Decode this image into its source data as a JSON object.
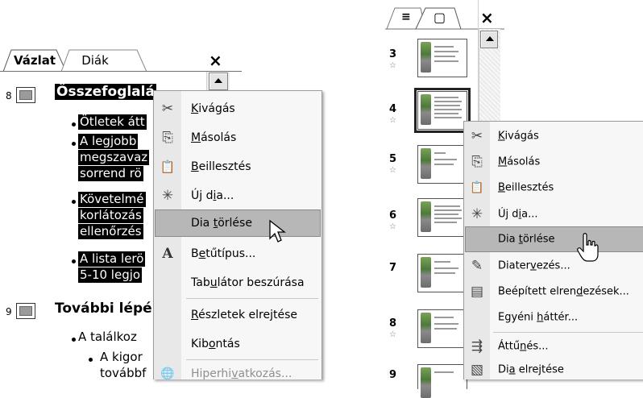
{
  "outline_pane": {
    "tabs": [
      "Vázlat",
      "Diák"
    ],
    "close": "×",
    "slides": [
      {
        "number": "8",
        "title": "Összefoglalás",
        "title_visible": "Összefoglalá",
        "bullets": [
          "Ötletek átt",
          "A legjobb",
          "megszavaz",
          "sorrend rö",
          "Követelmé",
          "korlátozás",
          "ellenőrzés",
          "A lista lerö",
          "5-10 legjo"
        ]
      },
      {
        "number": "9",
        "title": "További lépé",
        "bullets": [
          "A találkoz",
          "A kigor",
          "továbbf"
        ]
      }
    ]
  },
  "left_menu": {
    "items": [
      {
        "id": "cut",
        "pre": "",
        "acc": "K",
        "post": "ivágás",
        "icon": "scissors-icon",
        "glyph": "✂"
      },
      {
        "id": "copy",
        "pre": "",
        "acc": "M",
        "post": "ásolás",
        "icon": "copy-icon",
        "glyph": "⎘"
      },
      {
        "id": "paste",
        "pre": "",
        "acc": "B",
        "post": "eillesztés",
        "icon": "paste-icon",
        "glyph": "📋"
      },
      {
        "id": "new-slide",
        "pre": "Új d",
        "acc": "i",
        "post": "a...",
        "icon": "new-slide-icon",
        "glyph": "✳"
      },
      {
        "id": "delete-slide",
        "pre": "Dia ",
        "acc": "t",
        "post": "örlése",
        "icon": "",
        "glyph": ""
      },
      {
        "id": "font",
        "pre": "B",
        "acc": "e",
        "post": "tűtípus...",
        "icon": "font-icon",
        "glyph": "A"
      },
      {
        "id": "tab",
        "pre": "Tab",
        "acc": "u",
        "post": "látor beszúrása",
        "icon": "",
        "glyph": ""
      },
      {
        "id": "hide-details",
        "pre": "",
        "acc": "R",
        "post": "észletek elrejtése",
        "icon": "",
        "glyph": ""
      },
      {
        "id": "expand",
        "pre": "Kib",
        "acc": "o",
        "post": "ntás",
        "icon": "",
        "glyph": ""
      },
      {
        "id": "hyperlink",
        "pre": "Hiperhi",
        "acc": "v",
        "post": "atkozás...",
        "icon": "hyperlink-icon",
        "glyph": "🌐"
      }
    ]
  },
  "slides_pane": {
    "tabs": [
      "≡",
      "▢"
    ],
    "close": "×",
    "thumbs": [
      {
        "number": "3",
        "star": "☆"
      },
      {
        "number": "4",
        "star": "☆"
      },
      {
        "number": "5",
        "star": "☆"
      },
      {
        "number": "6",
        "star": "☆"
      },
      {
        "number": "7",
        "star": ""
      },
      {
        "number": "8",
        "star": "☆"
      },
      {
        "number": "9",
        "star": ""
      }
    ]
  },
  "right_menu": {
    "items": [
      {
        "id": "cut",
        "pre": "",
        "acc": "K",
        "post": "ivágás",
        "icon": "scissors-icon",
        "glyph": "✂"
      },
      {
        "id": "copy",
        "pre": "",
        "acc": "M",
        "post": "ásolás",
        "icon": "copy-icon",
        "glyph": "⎘"
      },
      {
        "id": "paste",
        "pre": "",
        "acc": "B",
        "post": "eillesztés",
        "icon": "paste-icon",
        "glyph": "📋"
      },
      {
        "id": "new-slide",
        "pre": "Új d",
        "acc": "i",
        "post": "a...",
        "icon": "new-slide-icon",
        "glyph": "✳"
      },
      {
        "id": "delete-slide",
        "pre": "Dia ",
        "acc": "t",
        "post": "örlése",
        "icon": "",
        "glyph": ""
      },
      {
        "id": "design",
        "pre": "Diater",
        "acc": "v",
        "post": "ezés...",
        "icon": "design-icon",
        "glyph": "✎"
      },
      {
        "id": "layouts",
        "pre": "Beépített elren",
        "acc": "d",
        "post": "ezések...",
        "icon": "layout-icon",
        "glyph": "▤"
      },
      {
        "id": "background",
        "pre": "Egyéni ",
        "acc": "h",
        "post": "áttér...",
        "icon": "",
        "glyph": ""
      },
      {
        "id": "transition",
        "pre": "Áttű",
        "acc": "n",
        "post": "és...",
        "icon": "transition-icon",
        "glyph": "⇶"
      },
      {
        "id": "hide-slide",
        "pre": "Di",
        "acc": "a",
        "post": " elrejtése",
        "icon": "hide-slide-icon",
        "glyph": "▧"
      }
    ]
  }
}
